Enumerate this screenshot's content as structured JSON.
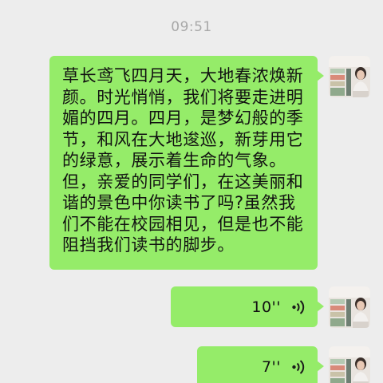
{
  "status": {
    "time": "09:51"
  },
  "messages": [
    {
      "type": "text",
      "sender": "self",
      "text": "草长鸢飞四月天，大地春浓焕新颜。时光悄悄，我们将要走进明媚的四月。四月，是梦幻般的季节，和风在大地逡巡，新芽用它的绿意，展示着生命的气象。但，亲爱的同学们，在这美丽和谐的景色中你读书了吗?虽然我们不能在校园相见，但是也不能阻挡我们读书的脚步。"
    },
    {
      "type": "voice",
      "sender": "self",
      "duration": "10''"
    },
    {
      "type": "voice",
      "sender": "self",
      "duration": "7''"
    }
  ],
  "colors": {
    "background": "#ededed",
    "bubble": "#95ec69",
    "timestamp": "#a8a8a8"
  },
  "icons": {
    "voice": "voice-wave-icon",
    "avatar": "user-avatar-photo"
  }
}
